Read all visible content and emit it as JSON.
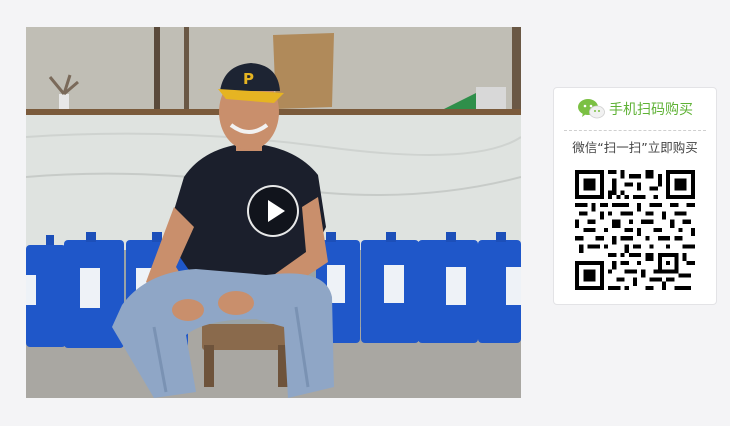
{
  "video": {
    "play_button_label": "play",
    "poster_description_icon": "play-icon"
  },
  "qr_panel": {
    "title": "手机扫码购买",
    "subtitle": "微信“扫一扫”立即购买",
    "icon": "wechat-icon",
    "accent_color": "#5fb236"
  }
}
